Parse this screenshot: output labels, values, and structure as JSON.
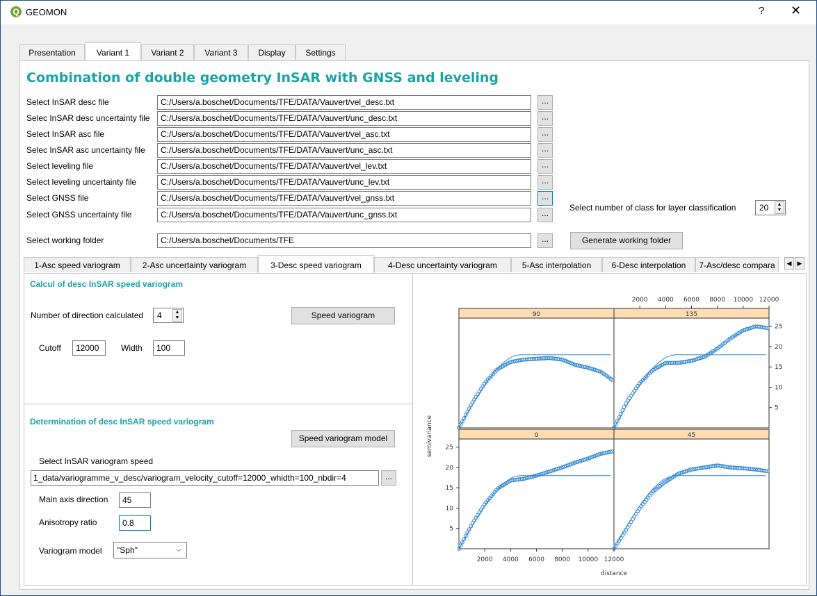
{
  "window": {
    "title": "GEOMON",
    "help_glyph": "?",
    "close_glyph": "✕",
    "logo_glyph": "Q"
  },
  "top_tabs": [
    "Presentation",
    "Variant 1",
    "Variant 2",
    "Variant 3",
    "Display",
    "Settings"
  ],
  "top_tab_active": "Variant 1",
  "heading": "Combination of double geometry InSAR with GNSS and leveling",
  "file_rows": [
    {
      "label": "Select InSAR desc file",
      "value": "C:/Users/a.boschet/Documents/TFE/DATA/Vauvert/vel_desc.txt"
    },
    {
      "label": "Selec InSAR desc uncertainty file",
      "value": "C:/Users/a.boschet/Documents/TFE/DATA/Vauvert/unc_desc.txt"
    },
    {
      "label": "Select InSAR asc file",
      "value": "C:/Users/a.boschet/Documents/TFE/DATA/Vauvert/vel_asc.txt"
    },
    {
      "label": "Selec InSAR asc uncertainty file",
      "value": "C:/Users/a.boschet/Documents/TFE/DATA/Vauvert/unc_asc.txt"
    },
    {
      "label": "Select leveling file",
      "value": "C:/Users/a.boschet/Documents/TFE/DATA/Vauvert/vel_lev.txt"
    },
    {
      "label": "Select leveling uncertainty file",
      "value": "C:/Users/a.boschet/Documents/TFE/DATA/Vauvert/unc_lev.txt"
    },
    {
      "label": "Select GNSS file",
      "value": "C:/Users/a.boschet/Documents/TFE/DATA/Vauvert/vel_gnss.txt"
    },
    {
      "label": "Select GNSS uncertainty file",
      "value": "C:/Users/a.boschet/Documents/TFE/DATA/Vauvert/unc_gnss.txt"
    }
  ],
  "browse_label": "...",
  "working_folder": {
    "label": "Select working folder",
    "value": "C:/Users/a.boschet/Documents/TFE",
    "button": "Generate working folder"
  },
  "classes": {
    "label": "Select number of class for layer classification",
    "value": "20"
  },
  "sub_tabs": [
    "1-Asc speed variogram",
    "2-Asc uncertainty variogram",
    "3-Desc speed variogram",
    "4-Desc uncertainty variogram",
    "5-Asc interpolation",
    "6-Desc interpolation",
    "7-Asc/desc compara"
  ],
  "sub_tab_active": "3-Desc speed variogram",
  "calc_group": {
    "title": "Calcul of desc InSAR speed variogram",
    "directions_label": "Number of direction calculated",
    "directions_value": "4",
    "button": "Speed variogram",
    "cutoff_label": "Cutoff",
    "cutoff_value": "12000",
    "width_label": "Width",
    "width_value": "100"
  },
  "model_group": {
    "title": "Determination of desc InSAR speed variogram",
    "button": "Speed variogram model",
    "select_label": "Select InSAR variogram speed",
    "select_value": "1_data/variogramme_v_desc/variogram_velocity_cutoff=12000_whidth=100_nbdir=4",
    "axis_label": "Main axis direction",
    "axis_value": "45",
    "anisotropy_label": "Anisotropy ratio",
    "anisotropy_value": "0.8",
    "model_label": "Variogram model",
    "model_value": "\"Sph\""
  },
  "chart_data": {
    "type": "scatter",
    "xlabel": "distance",
    "ylabel": "semivariance",
    "xlim": [
      0,
      12000
    ],
    "ylim": [
      0,
      27
    ],
    "x_ticks": [
      2000,
      4000,
      6000,
      8000,
      10000,
      12000
    ],
    "y_ticks": [
      5,
      10,
      15,
      20,
      25
    ],
    "panels": [
      {
        "name": "90",
        "model_sill": 18,
        "model_range": 4800,
        "x": [
          0,
          1000,
          2000,
          3000,
          4000,
          5000,
          6000,
          7000,
          8000,
          9000,
          10000,
          11000,
          12000
        ],
        "y": [
          0,
          6,
          11,
          14.5,
          16.2,
          16.8,
          17.0,
          17.2,
          16.8,
          15.5,
          14.8,
          13.8,
          11.5
        ]
      },
      {
        "name": "135",
        "model_sill": 18,
        "model_range": 4800,
        "x": [
          0,
          1000,
          2000,
          3000,
          4000,
          5000,
          6000,
          7000,
          8000,
          9000,
          10000,
          11000,
          12000
        ],
        "y": [
          0,
          6.5,
          11,
          14.2,
          16.0,
          16.0,
          16.5,
          17.5,
          19.5,
          22.0,
          24.0,
          25.0,
          24.5
        ]
      },
      {
        "name": "0",
        "model_sill": 18,
        "model_range": 4800,
        "x": [
          0,
          1000,
          2000,
          3000,
          4000,
          5000,
          6000,
          7000,
          8000,
          9000,
          10000,
          11000,
          12000
        ],
        "y": [
          0,
          6,
          11,
          14.8,
          16.8,
          17.2,
          18.0,
          19.0,
          20.0,
          21.2,
          22.2,
          23.4,
          24.0
        ]
      },
      {
        "name": "45",
        "model_sill": 18,
        "model_range": 4800,
        "x": [
          0,
          1000,
          2000,
          3000,
          4000,
          5000,
          6000,
          7000,
          8000,
          9000,
          10000,
          11000,
          12000
        ],
        "y": [
          0,
          5,
          10,
          14,
          16.5,
          18.5,
          19.5,
          20.0,
          20.5,
          20.0,
          19.8,
          19.5,
          19.0
        ]
      }
    ]
  },
  "colors": {
    "accent": "#18a3a6",
    "points": "#2f86d1",
    "model": "#2f86d1",
    "strip": "#ffdcb2"
  }
}
